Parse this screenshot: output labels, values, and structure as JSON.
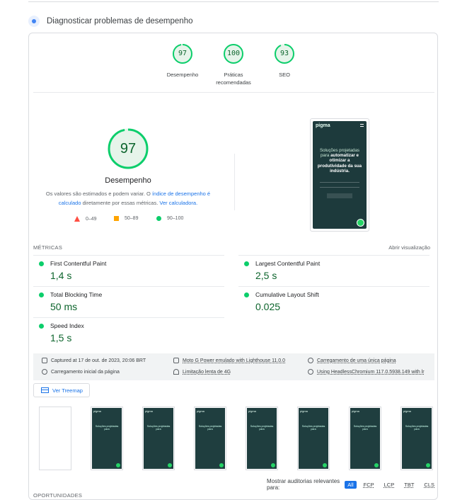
{
  "section": {
    "title": "Diagnosticar problemas de desempenho"
  },
  "summary": [
    {
      "score": "97",
      "label": "Desempenho"
    },
    {
      "score": "100",
      "label": "Práticas recomendadas"
    },
    {
      "score": "93",
      "label": "SEO"
    }
  ],
  "main": {
    "score": "97",
    "title": "Desempenho",
    "note_pre": "Os valores são estimados e podem variar. O ",
    "note_link1": "índice de desempenho é calculado",
    "note_mid": " diretamente por essas métricas. ",
    "note_link2": "Ver calculadora.",
    "legend": [
      {
        "range": "0–49",
        "color": "#ff4e42"
      },
      {
        "range": "50–89",
        "color": "#ffa400"
      },
      {
        "range": "90–100",
        "color": "#0cce6b"
      }
    ]
  },
  "screenshot": {
    "logo": "pigma",
    "line1": "Soluções projetadas para",
    "line2": "automatizar e otimizar a produtividade da sua indústria."
  },
  "metrics": {
    "label": "MÉTRICAS",
    "expand": "Abrir visualização",
    "items": [
      {
        "name": "First Contentful Paint",
        "value": "1,4 s"
      },
      {
        "name": "Largest Contentful Paint",
        "value": "2,5 s"
      },
      {
        "name": "Total Blocking Time",
        "value": "50 ms"
      },
      {
        "name": "Cumulative Layout Shift",
        "value": "0.025"
      },
      {
        "name": "Speed Index",
        "value": "1,5 s"
      }
    ]
  },
  "info": {
    "captured": "Captured at 17 de out. de 2023, 20:06 BRT",
    "device": "Moto G Power emulado with Lighthouse 11.0.0",
    "load": "Carregamento de uma única página",
    "initial": "Carregamento inicial da página",
    "throttle": "Limitação lenta de 4G",
    "browser": "Using HeadlessChromium 117.0.5938.149 with lr"
  },
  "treemap": {
    "label": "Ver Treemap"
  },
  "audits": {
    "label": "Mostrar auditorias relevantes para:",
    "filters": [
      "All",
      "FCP",
      "LCP",
      "TBT",
      "CLS"
    ]
  },
  "opportunities": {
    "label": "OPORTUNIDADES"
  }
}
